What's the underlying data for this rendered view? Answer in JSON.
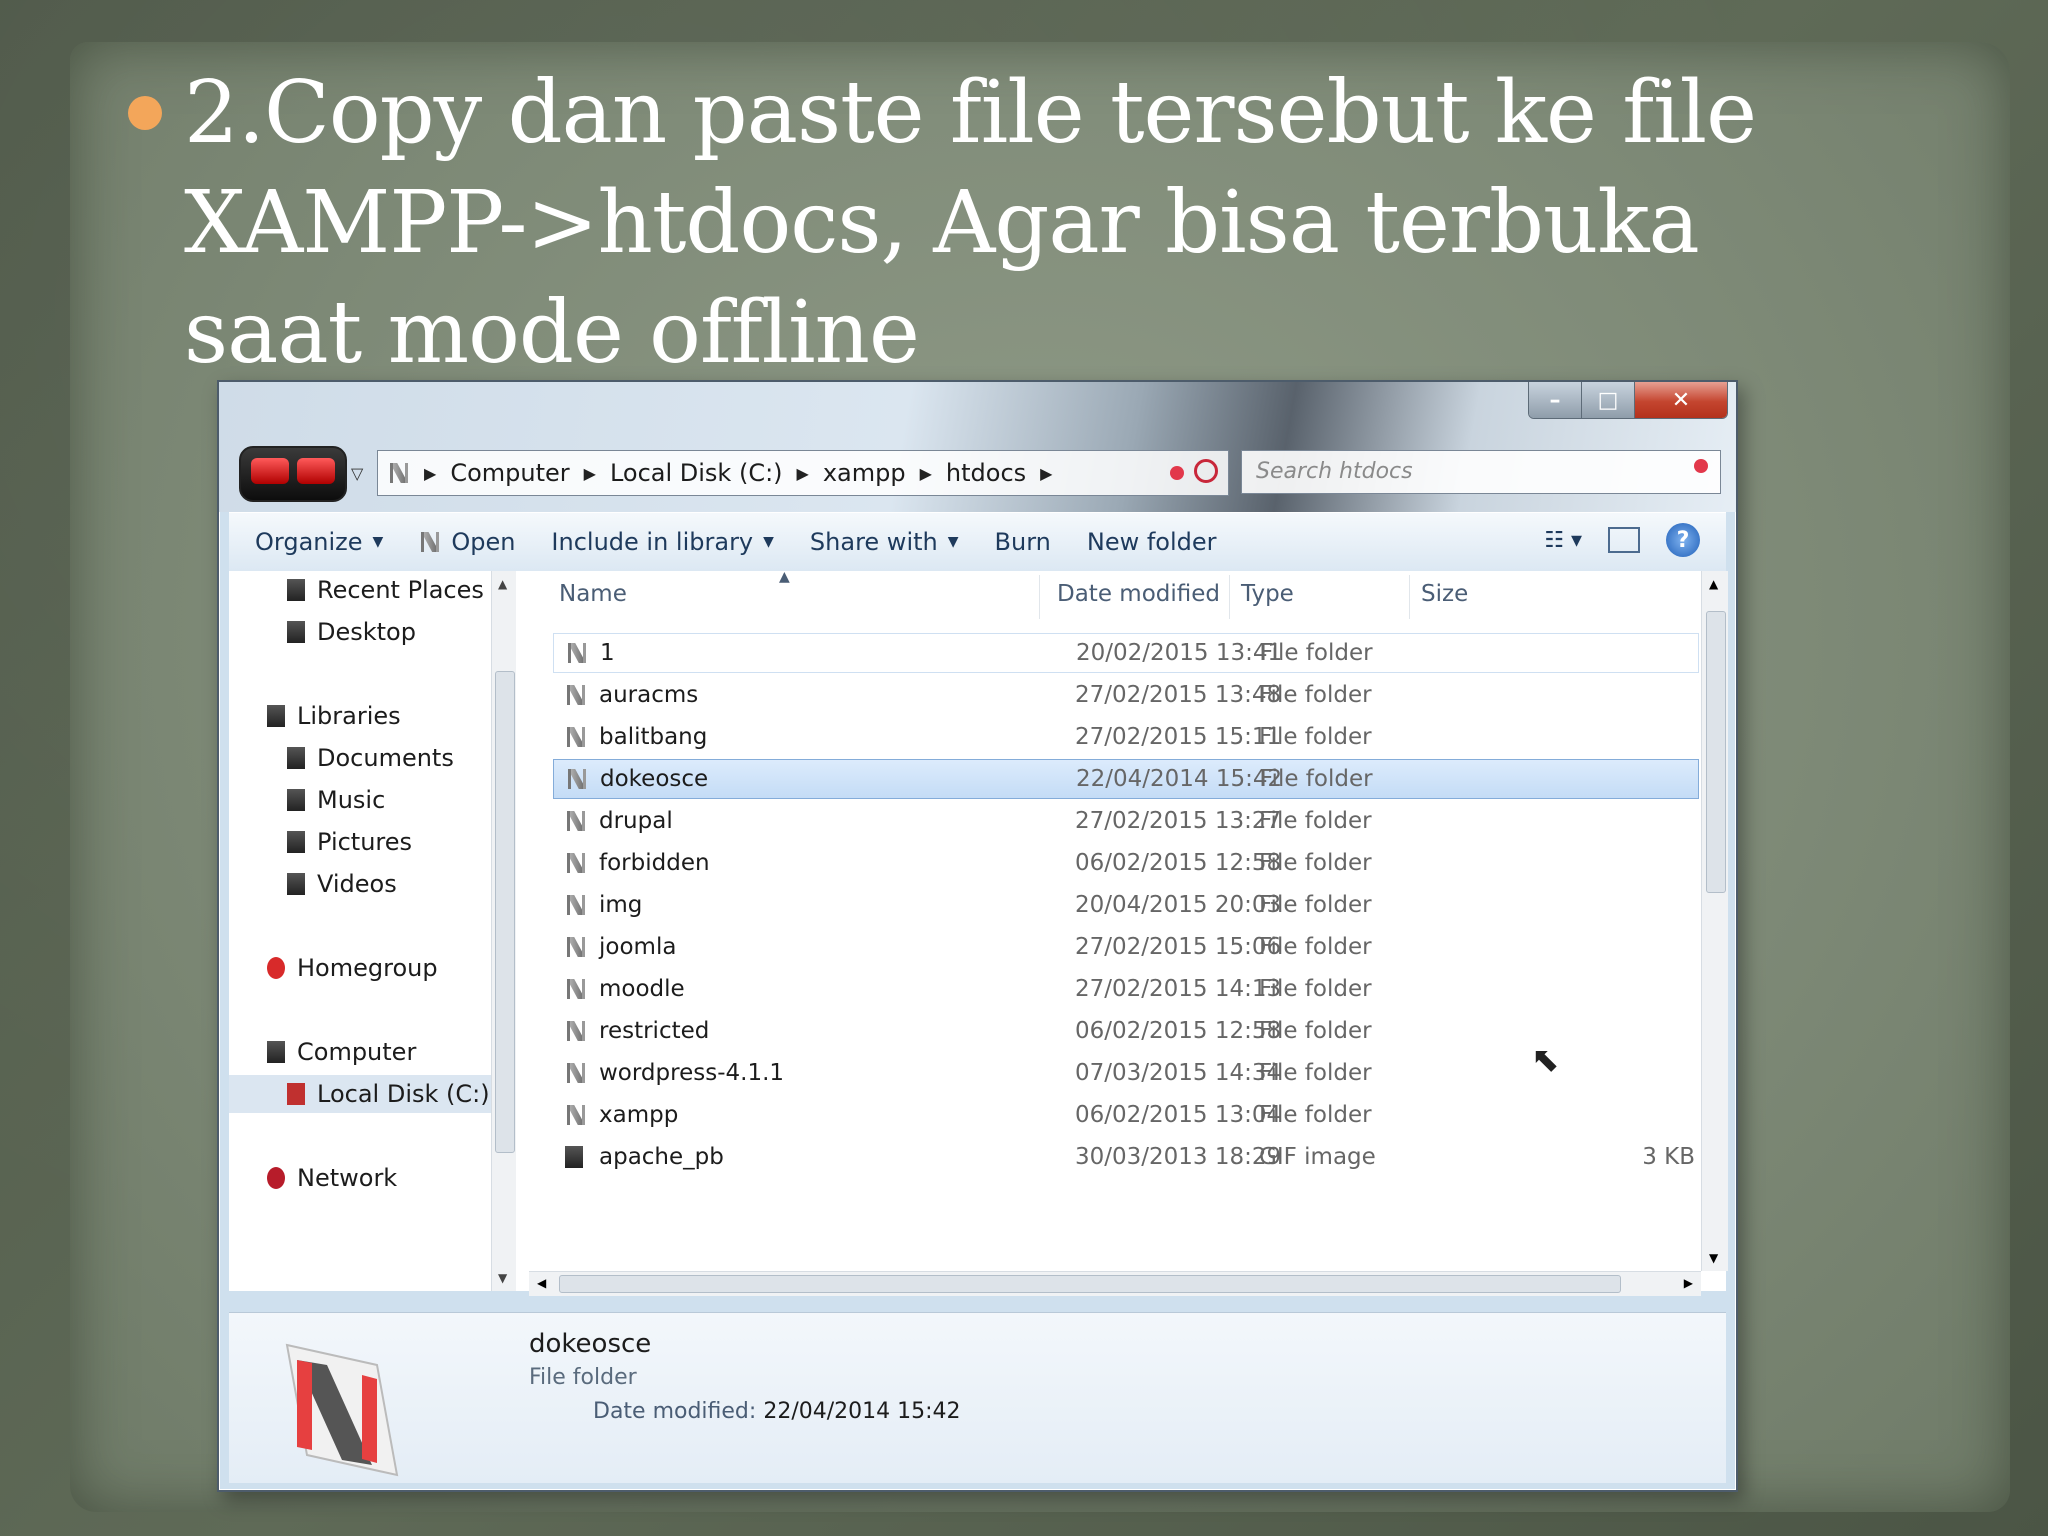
{
  "slide": {
    "bullet_text": "2.Copy dan paste file tersebut ke file XAMPP->htdocs, Agar bisa terbuka saat mode offline"
  },
  "window": {
    "controls": {
      "minimize": "–",
      "maximize": "□",
      "close": "✕"
    },
    "address": [
      "Computer",
      "Local Disk (C:)",
      "xampp",
      "htdocs"
    ],
    "search_placeholder": "Search htdocs",
    "toolbar": {
      "organize": "Organize",
      "open": "Open",
      "include_in_library": "Include in library",
      "share_with": "Share with",
      "burn": "Burn",
      "new_folder": "New folder"
    },
    "nav_pane": {
      "recent_places": "Recent Places",
      "desktop": "Desktop",
      "libraries": "Libraries",
      "documents": "Documents",
      "music": "Music",
      "pictures": "Pictures",
      "videos": "Videos",
      "homegroup": "Homegroup",
      "computer": "Computer",
      "local_disk": "Local Disk (C:)",
      "network": "Network"
    },
    "columns": {
      "name": "Name",
      "date_modified": "Date modified",
      "type": "Type",
      "size": "Size"
    },
    "files": [
      {
        "name": "1",
        "date": "20/02/2015 13:41",
        "type": "File folder",
        "size": ""
      },
      {
        "name": "auracms",
        "date": "27/02/2015 13:48",
        "type": "File folder",
        "size": ""
      },
      {
        "name": "balitbang",
        "date": "27/02/2015 15:11",
        "type": "File folder",
        "size": ""
      },
      {
        "name": "dokeosce",
        "date": "22/04/2014 15:42",
        "type": "File folder",
        "size": ""
      },
      {
        "name": "drupal",
        "date": "27/02/2015 13:27",
        "type": "File folder",
        "size": ""
      },
      {
        "name": "forbidden",
        "date": "06/02/2015 12:58",
        "type": "File folder",
        "size": ""
      },
      {
        "name": "img",
        "date": "20/04/2015 20:03",
        "type": "File folder",
        "size": ""
      },
      {
        "name": "joomla",
        "date": "27/02/2015 15:06",
        "type": "File folder",
        "size": ""
      },
      {
        "name": "moodle",
        "date": "27/02/2015 14:13",
        "type": "File folder",
        "size": ""
      },
      {
        "name": "restricted",
        "date": "06/02/2015 12:58",
        "type": "File folder",
        "size": ""
      },
      {
        "name": "wordpress-4.1.1",
        "date": "07/03/2015 14:34",
        "type": "File folder",
        "size": ""
      },
      {
        "name": "xampp",
        "date": "06/02/2015 13:04",
        "type": "File folder",
        "size": ""
      },
      {
        "name": "apache_pb",
        "date": "30/03/2013 18:29",
        "type": "GIF image",
        "size": "3 KB"
      }
    ],
    "selected_file": "dokeosce",
    "details": {
      "name": "dokeosce",
      "type": "File folder",
      "date_label": "Date modified:",
      "date_value": "22/04/2014 15:42"
    }
  },
  "colors": {
    "bullet": "#f3a65a",
    "selection": "#c4dcf6",
    "link_text": "#1e3a5c"
  }
}
